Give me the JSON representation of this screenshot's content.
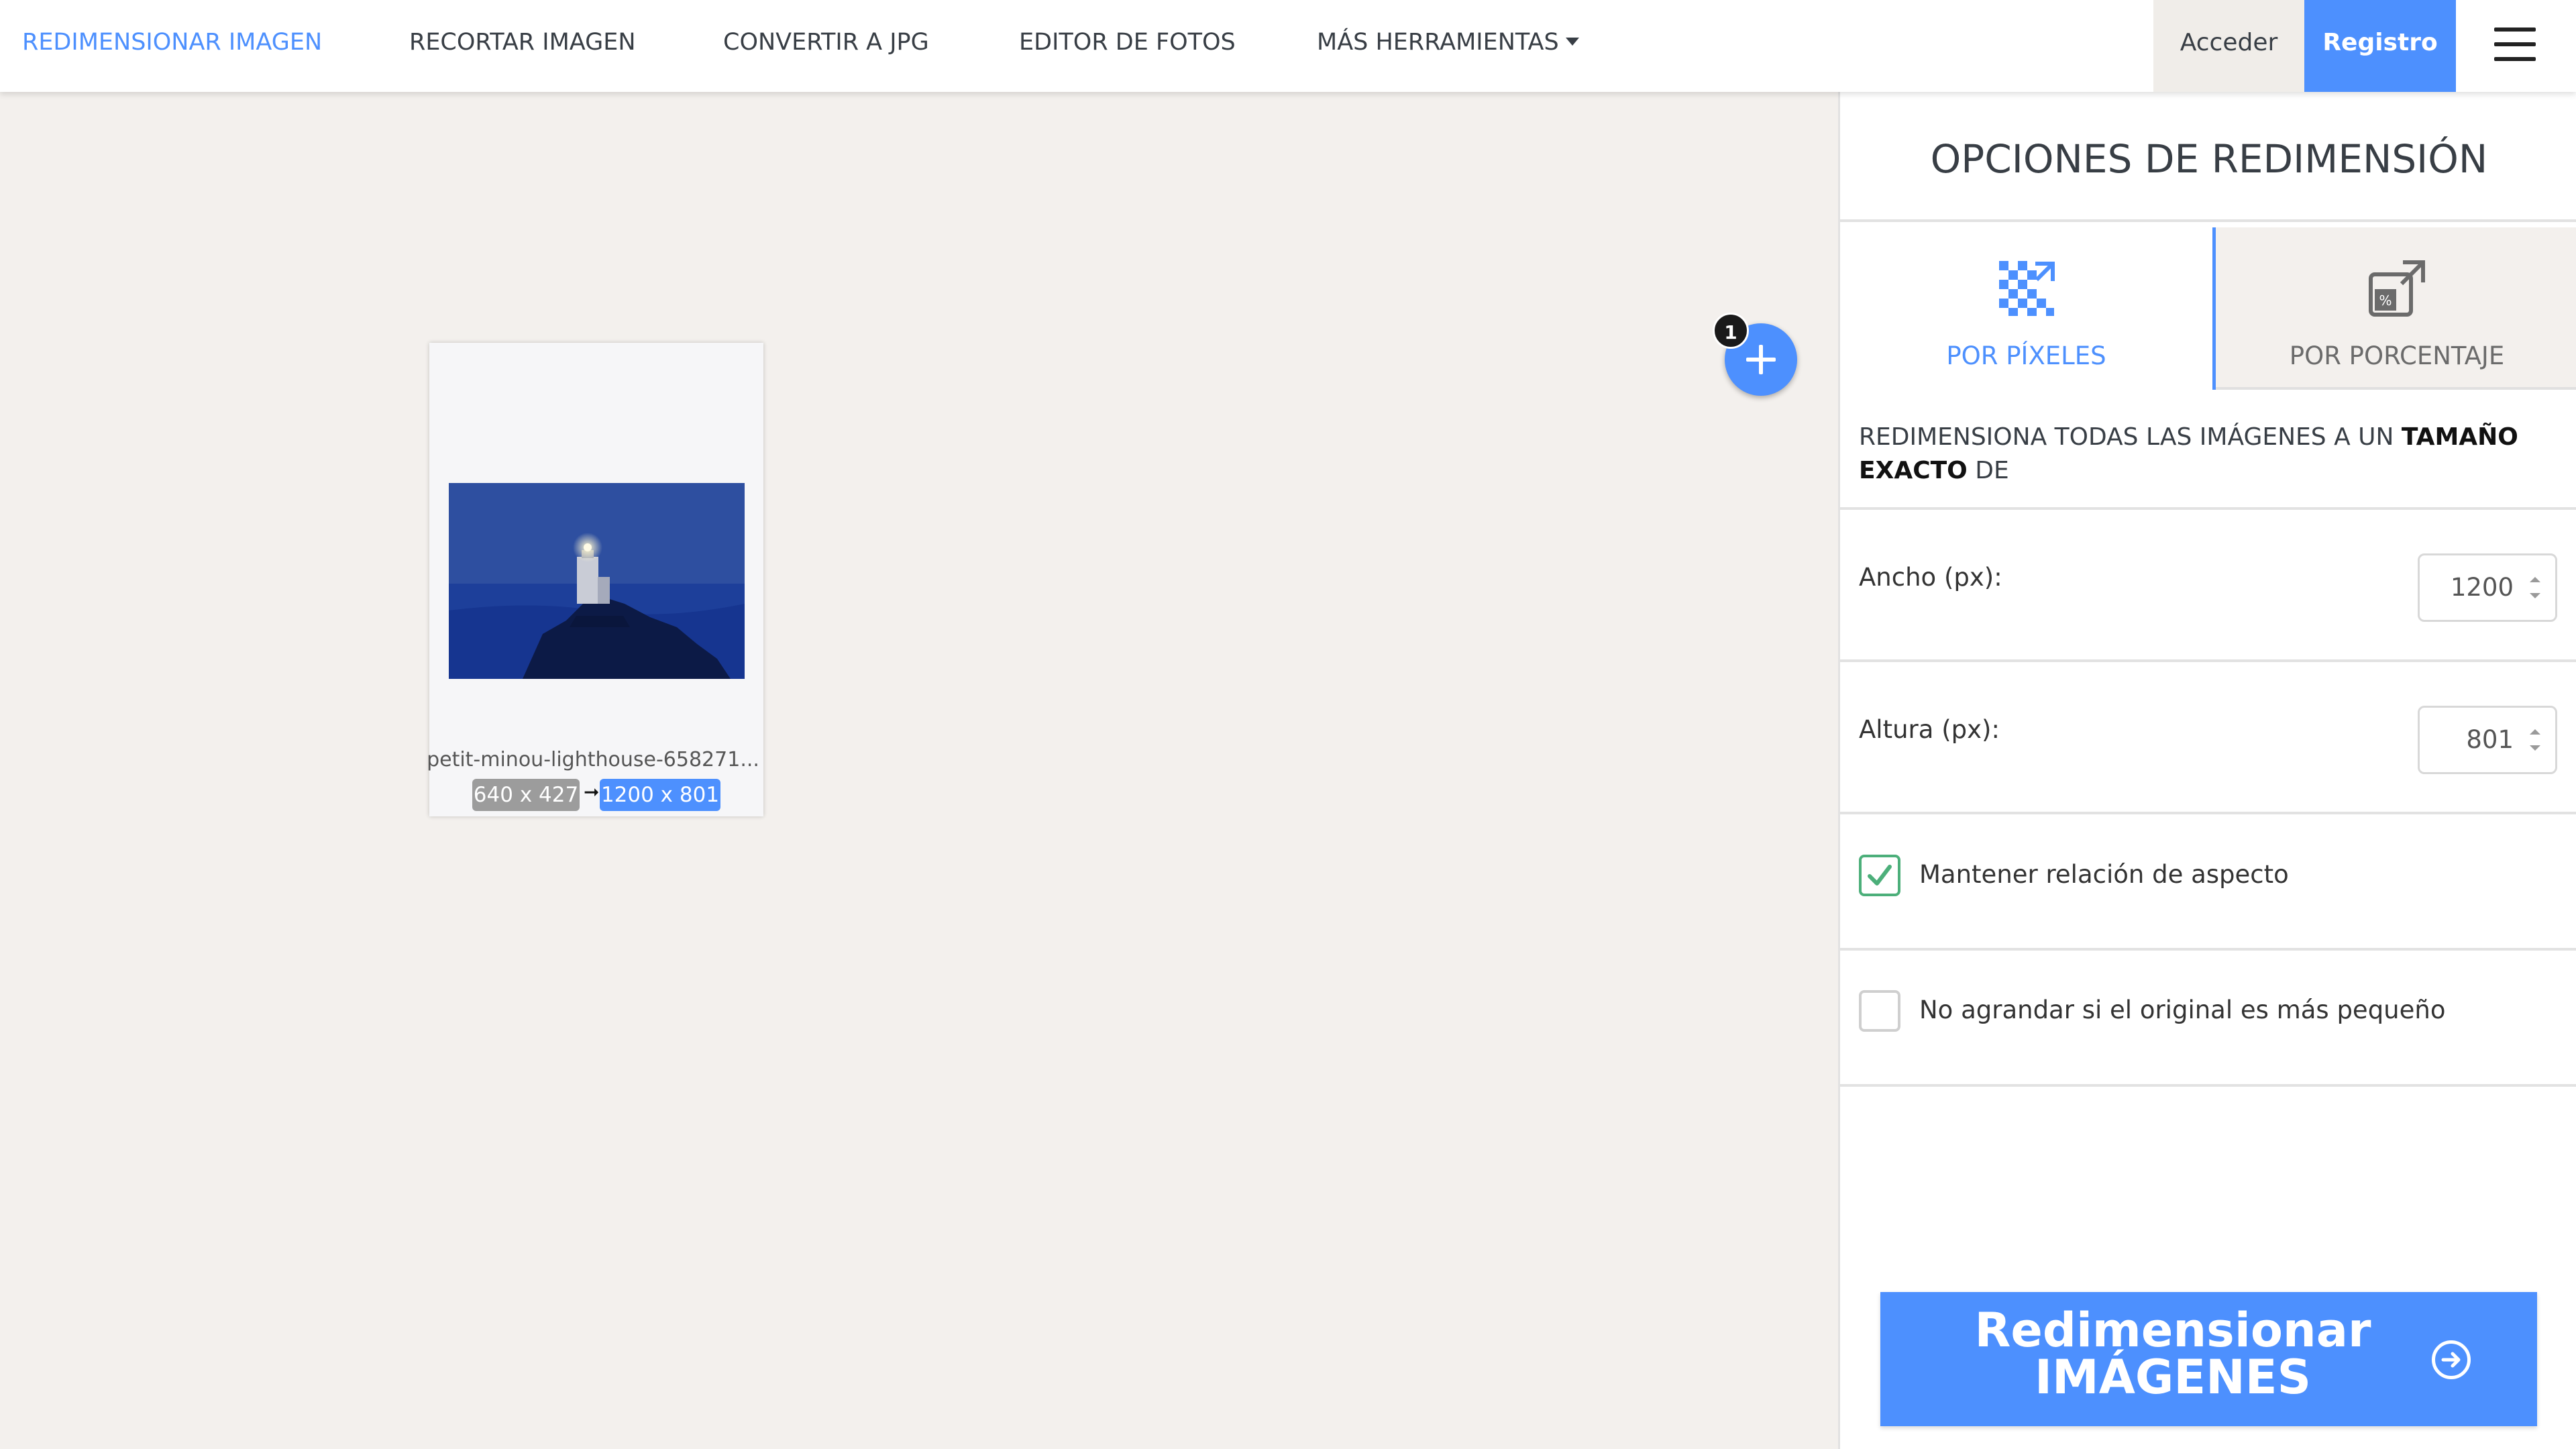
{
  "nav": {
    "items": [
      {
        "label": "REDIMENSIONAR IMAGEN",
        "active": true
      },
      {
        "label": "RECORTAR IMAGEN",
        "active": false
      },
      {
        "label": "CONVERTIR A JPG",
        "active": false
      },
      {
        "label": "EDITOR DE FOTOS",
        "active": false
      },
      {
        "label": "MÁS HERRAMIENTAS",
        "active": false
      }
    ],
    "login_label": "Acceder",
    "register_label": "Registro"
  },
  "workspace": {
    "file": {
      "name": "petit-minou-lighthouse-658271...",
      "original_size": "640 x 427",
      "new_size": "1200 x 801"
    },
    "add_button_badge": "1"
  },
  "panel": {
    "title": "OPCIONES DE REDIMENSIÓN",
    "tabs": [
      {
        "label": "POR PÍXELES",
        "icon": "pixels-resize-icon",
        "selected": true
      },
      {
        "label": "POR PORCENTAJE",
        "icon": "percent-resize-icon",
        "selected": false
      }
    ],
    "instruction": {
      "prefix": "REDIMENSIONA TODAS LAS IMÁGENES A UN ",
      "bold": "TAMAÑO EXACTO",
      "suffix": " DE"
    },
    "width": {
      "label": "Ancho (px):",
      "value": "1200"
    },
    "height": {
      "label": "Altura (px):",
      "value": "801"
    },
    "keep_aspect": {
      "label": "Mantener relación de aspecto",
      "checked": true
    },
    "no_enlarge": {
      "label": "No agrandar si el original es más pequeño",
      "checked": false
    },
    "submit": {
      "line1": "Redimensionar",
      "line2": "IMÁGENES"
    }
  },
  "colors": {
    "accent": "#4d90fe",
    "workspace_bg": "#f3f0ed",
    "check_green": "#4caf7a"
  }
}
